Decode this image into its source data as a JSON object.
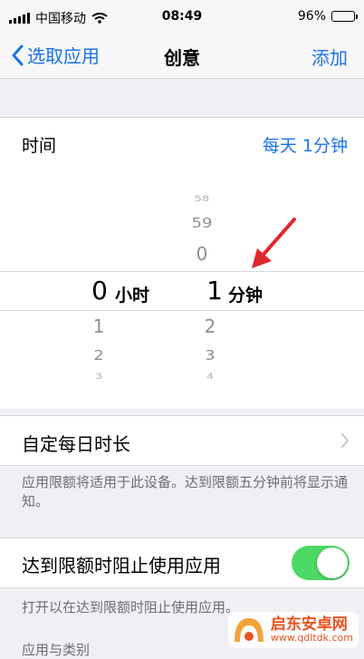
{
  "status_bar": {
    "carrier": "中国移动",
    "time": "08:49",
    "battery_percent": "96%",
    "battery_level": 0.96
  },
  "nav": {
    "back_label": "选取应用",
    "title": "创意",
    "action_label": "添加"
  },
  "time_row": {
    "label": "时间",
    "value": "每天 1分钟"
  },
  "picker": {
    "hours": {
      "above": [],
      "selected": "0",
      "below": [
        "1",
        "2",
        "3"
      ],
      "unit": "小时"
    },
    "minutes": {
      "above": [
        "58",
        "59",
        "0"
      ],
      "selected": "1",
      "below": [
        "2",
        "3",
        "4"
      ],
      "unit": "分钟"
    }
  },
  "custom_daily": {
    "label": "自定每日时长"
  },
  "note_limit": "应用限额将适用于此设备。达到限额五分钟前将显示通知。",
  "block_at_limit": {
    "label": "达到限额时阻止使用应用",
    "enabled": true
  },
  "note_block": "打开以在达到限额时阻止使用应用。",
  "section_header": "应用与类别",
  "watermark": {
    "title": "启东安卓网",
    "url": "www.qdltdk.com"
  },
  "colors": {
    "accent": "#1a73e8",
    "toggle_on": "#4cd964",
    "arrow": "#e0272e",
    "watermark": "#e8541f"
  }
}
